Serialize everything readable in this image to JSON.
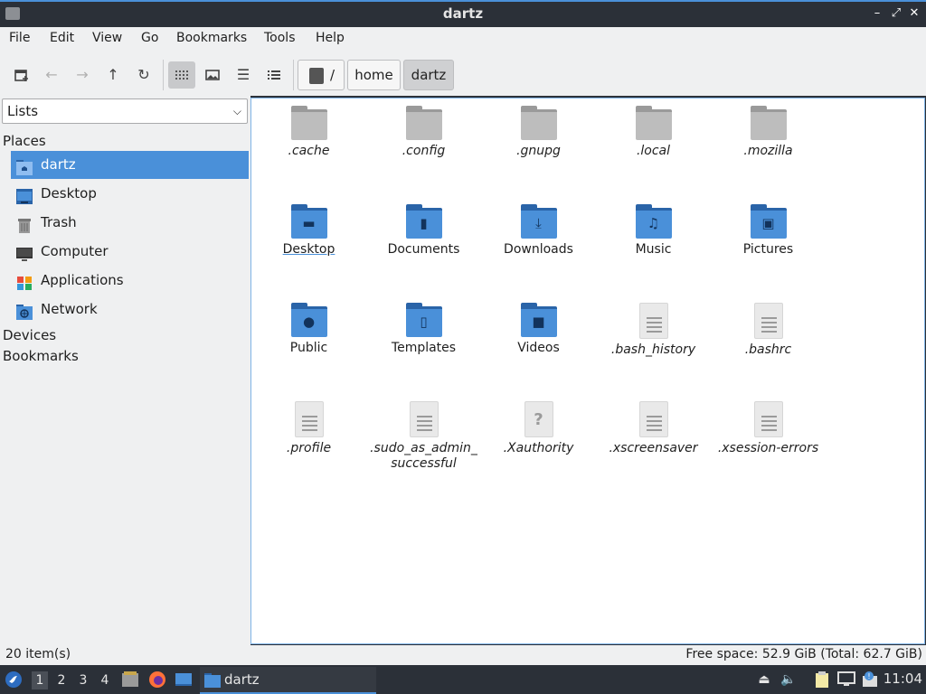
{
  "window": {
    "title": "dartz"
  },
  "menu": [
    "File",
    "Edit",
    "View",
    "Go",
    "Bookmarks",
    "Tools",
    "Help"
  ],
  "toolbar": {
    "breadcrumbs": [
      {
        "label": "/",
        "icon": "drive-icon"
      },
      {
        "label": "home"
      },
      {
        "label": "dartz",
        "current": true
      }
    ]
  },
  "sidebar": {
    "selector": "Lists",
    "places_heading": "Places",
    "places": [
      {
        "label": "dartz",
        "icon": "home-folder-icon",
        "selected": true
      },
      {
        "label": "Desktop",
        "icon": "desktop-icon"
      },
      {
        "label": "Trash",
        "icon": "trash-icon"
      },
      {
        "label": "Computer",
        "icon": "computer-icon"
      },
      {
        "label": "Applications",
        "icon": "applications-icon"
      },
      {
        "label": "Network",
        "icon": "network-icon"
      }
    ],
    "devices_heading": "Devices",
    "bookmarks_heading": "Bookmarks"
  },
  "files": [
    {
      "name": ".cache",
      "kind": "folder",
      "hidden": true
    },
    {
      "name": ".config",
      "kind": "folder",
      "hidden": true
    },
    {
      "name": ".gnupg",
      "kind": "folder",
      "hidden": true
    },
    {
      "name": ".local",
      "kind": "folder",
      "hidden": true
    },
    {
      "name": ".mozilla",
      "kind": "folder",
      "hidden": true
    },
    {
      "name": "Desktop",
      "kind": "folder-desktop",
      "focused": true
    },
    {
      "name": "Documents",
      "kind": "folder-documents"
    },
    {
      "name": "Downloads",
      "kind": "folder-downloads"
    },
    {
      "name": "Music",
      "kind": "folder-music"
    },
    {
      "name": "Pictures",
      "kind": "folder-pictures"
    },
    {
      "name": "Public",
      "kind": "folder-public"
    },
    {
      "name": "Templates",
      "kind": "folder-templates"
    },
    {
      "name": "Videos",
      "kind": "folder-videos"
    },
    {
      "name": ".bash_history",
      "kind": "text",
      "hidden": true
    },
    {
      "name": ".bashrc",
      "kind": "text",
      "hidden": true
    },
    {
      "name": ".profile",
      "kind": "text",
      "hidden": true
    },
    {
      "name": ".sudo_as_admin_\nsuccessful",
      "kind": "text",
      "hidden": true
    },
    {
      "name": ".Xauthority",
      "kind": "unknown",
      "hidden": true
    },
    {
      "name": ".xscreensaver",
      "kind": "text",
      "hidden": true
    },
    {
      "name": ".xsession-errors",
      "kind": "text",
      "hidden": true
    }
  ],
  "status": {
    "count": "20 item(s)",
    "free_space": "Free space: 52.9 GiB (Total: 62.7 GiB)"
  },
  "taskbar": {
    "workspaces": [
      "1",
      "2",
      "3",
      "4"
    ],
    "active_workspace": "1",
    "task_label": "dartz",
    "clock": "11:04"
  },
  "colors": {
    "accent": "#4a90d9",
    "panel": "#2b3038",
    "folder_blue": "#4a90d9",
    "folder_grey": "#bdbdbd"
  }
}
